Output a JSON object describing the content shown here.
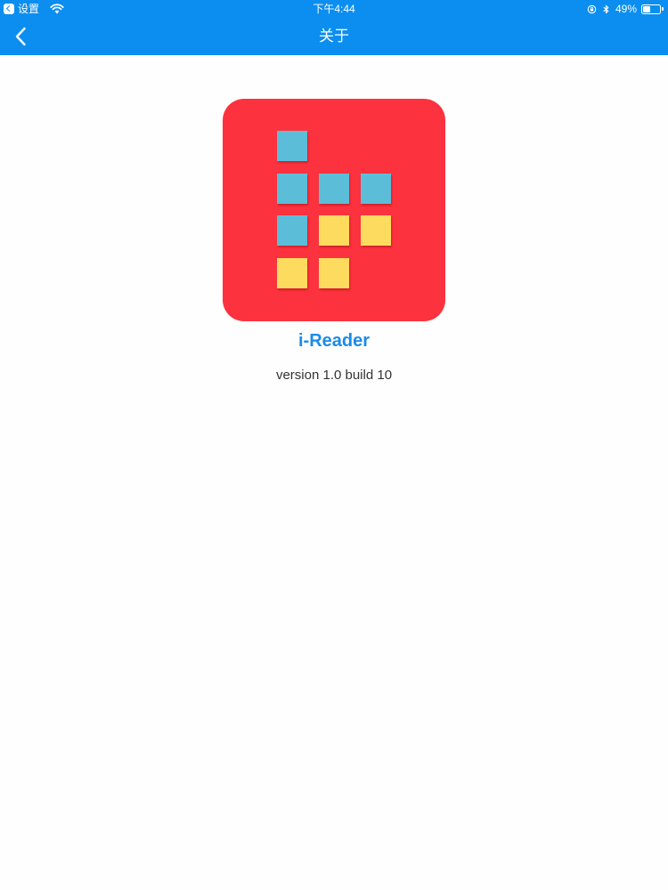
{
  "status_bar": {
    "back_app_label": "设置",
    "time": "下午4:44",
    "battery_percent": "49%",
    "battery_level": 0.49
  },
  "nav": {
    "title": "关于",
    "back_icon": "chevron-left-icon"
  },
  "app": {
    "name": "i-Reader",
    "version": "version 1.0 build 10",
    "icon_background": "#fd323f",
    "tile_blue": "#5cbdd9",
    "tile_yellow": "#fddb5e"
  },
  "colors": {
    "header": "#0b8ef0",
    "app_name": "#1a8be8"
  }
}
